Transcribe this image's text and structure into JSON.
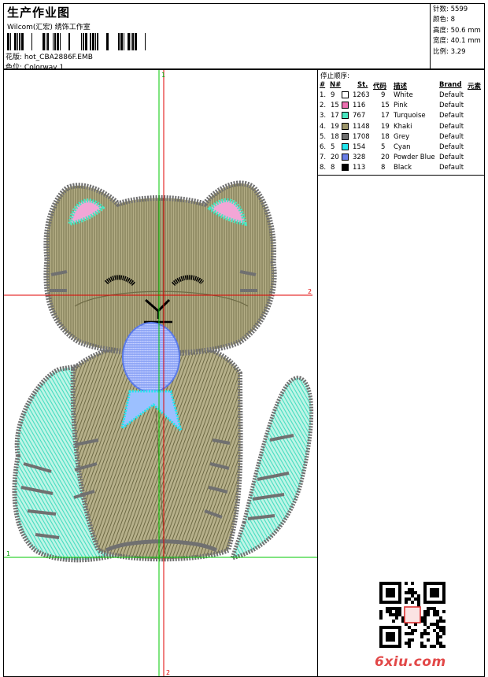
{
  "header": {
    "title": "生产作业图",
    "company": "Wilcom(汇宏) 绣饰工作室",
    "filename_label": "花版:",
    "filename": "hot_CBA2886F.EMB",
    "colorway_label": "色位:",
    "colorway": "Colorway 1"
  },
  "stats": [
    {
      "label": "针数:",
      "value": "5599"
    },
    {
      "label": "颜色:",
      "value": "8"
    },
    {
      "label": "高度:",
      "value": "50.6 mm"
    },
    {
      "label": "宽度:",
      "value": "40.1 mm"
    },
    {
      "label": "比例:",
      "value": "3.29"
    }
  ],
  "stop_sequence": {
    "title": "停止顺序:",
    "columns": [
      "#",
      "N#",
      "St.",
      "代码",
      "描述",
      "Brand",
      "元素"
    ],
    "rows": [
      {
        "idx": "1.",
        "n": "9",
        "st": "1263",
        "code": "9",
        "desc": "White",
        "brand": "Default",
        "color": "#ffffff"
      },
      {
        "idx": "2.",
        "n": "15",
        "st": "116",
        "code": "15",
        "desc": "Pink",
        "brand": "Default",
        "color": "#ec6fb0"
      },
      {
        "idx": "3.",
        "n": "17",
        "st": "767",
        "code": "17",
        "desc": "Turquoise",
        "brand": "Default",
        "color": "#48e6c0"
      },
      {
        "idx": "4.",
        "n": "19",
        "st": "1148",
        "code": "19",
        "desc": "Khaki",
        "brand": "Default",
        "color": "#9c956a"
      },
      {
        "idx": "5.",
        "n": "18",
        "st": "1708",
        "code": "18",
        "desc": "Grey",
        "brand": "Default",
        "color": "#6f6f6f"
      },
      {
        "idx": "6.",
        "n": "5",
        "st": "154",
        "code": "5",
        "desc": "Cyan",
        "brand": "Default",
        "color": "#21e6ee"
      },
      {
        "idx": "7.",
        "n": "20",
        "st": "328",
        "code": "20",
        "desc": "Powder Blue",
        "brand": "Default",
        "color": "#6a7ee6"
      },
      {
        "idx": "8.",
        "n": "8",
        "st": "113",
        "code": "8",
        "desc": "Black",
        "brand": "Default",
        "color": "#000000"
      }
    ]
  },
  "canvas": {
    "axis_labels": {
      "v_top": "1",
      "h_right": "2",
      "h_left": "1",
      "v_bottom": "2"
    },
    "guide_colors": {
      "green": "#00c800",
      "red": "#e00000"
    }
  },
  "watermark": {
    "text": "6xiu.com",
    "qr_icon": "qr-code-icon"
  }
}
